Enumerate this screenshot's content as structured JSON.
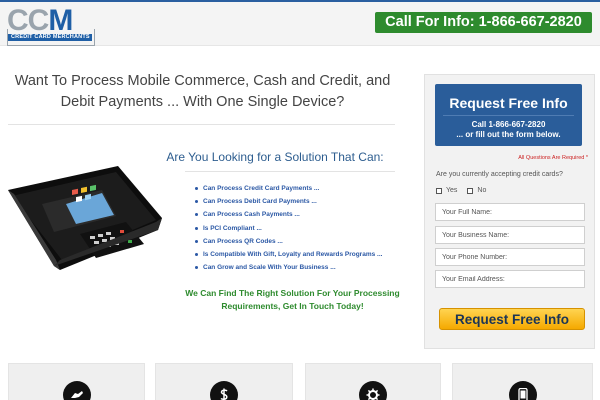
{
  "header": {
    "logo": {
      "letters": "CCM",
      "tagline": "CREDIT CARD MERCHANTS"
    },
    "call_badge": "Call For Info: 1-866-667-2820"
  },
  "main": {
    "headline": "Want To Process Mobile Commerce, Cash and Credit, and Debit Payments ... With One Single Device?",
    "subheading": "Are You Looking for a Solution That Can:",
    "benefits": [
      "Can Process Credit Card Payments ...",
      "Can Process Debit Card Payments ...",
      "Can Process Cash Payments ...",
      "Is PCI Compliant ...",
      "Can Process QR Codes ...",
      "Is Compatible With Gift, Loyalty and Rewards Programs ...",
      "Can Grow and Scale With Your Business ..."
    ],
    "cta": "We Can Find The Right Solution For Your Processing Requirements, Get In Touch Today!"
  },
  "form": {
    "title": "Request Free Info",
    "phone_line": "Call 1-866-667-2820",
    "subline": "... or fill out the form below.",
    "required_note": "All Questions Are Required *",
    "question": "Are you currently accepting credit cards?",
    "options": [
      "Yes",
      "No"
    ],
    "fields": {
      "name_placeholder": "Your Full Name:",
      "business_placeholder": "Your Business Name:",
      "phone_placeholder": "Your Phone Number:",
      "email_placeholder": "Your Email Address:"
    },
    "submit_label": "Request Free Info"
  },
  "feature_icons": [
    "hand-icon",
    "dollar-icon",
    "gear-icon",
    "mobile-phone-icon"
  ],
  "colors": {
    "brand_blue": "#2a5d9a",
    "green": "#2e8b2e",
    "button_yellow": "#f5a900",
    "link_blue": "#2b58a5"
  }
}
